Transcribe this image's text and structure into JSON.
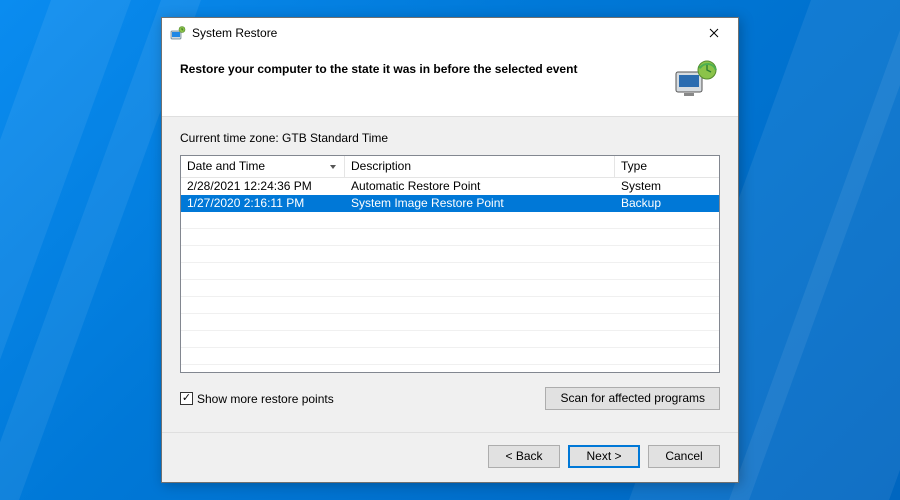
{
  "window": {
    "title": "System Restore"
  },
  "header": {
    "title": "Restore your computer to the state it was in before the selected event"
  },
  "timezone": {
    "label": "Current time zone: GTB Standard Time"
  },
  "grid": {
    "columns": {
      "date": "Date and Time",
      "desc": "Description",
      "type": "Type"
    },
    "rows": [
      {
        "date": "2/28/2021 12:24:36 PM",
        "desc": "Automatic Restore Point",
        "type": "System",
        "selected": false
      },
      {
        "date": "1/27/2020 2:16:11 PM",
        "desc": "System Image Restore Point",
        "type": "Backup",
        "selected": true
      }
    ]
  },
  "checkbox": {
    "label": "Show more restore points",
    "checked": true
  },
  "buttons": {
    "scan": "Scan for affected programs",
    "back": "< Back",
    "next": "Next >",
    "cancel": "Cancel"
  }
}
